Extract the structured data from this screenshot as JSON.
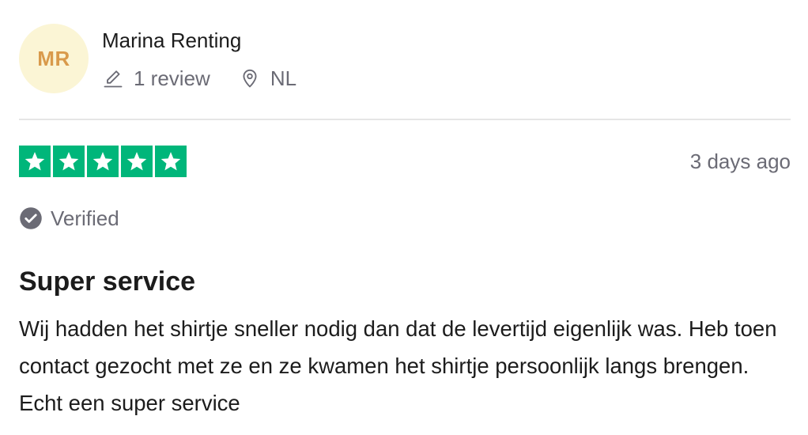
{
  "reviewer": {
    "initials": "MR",
    "name": "Marina Renting",
    "review_count": "1 review",
    "country": "NL",
    "avatar_bg": "#fbf5d5",
    "avatar_fg": "#d99a4b"
  },
  "review": {
    "rating": 5,
    "max_rating": 5,
    "star_color": "#00b67a",
    "date": "3 days ago",
    "verified_label": "Verified",
    "title": "Super service",
    "body": "Wij hadden het shirtje sneller nodig dan dat de levertijd eigenlijk was. Heb toen contact gezocht met ze en ze kwamen het shirtje persoonlijk langs brengen. Echt een super service"
  },
  "icons": {
    "review_count": "pencil-icon",
    "country": "location-pin-icon",
    "verified": "checkmark-circle-icon",
    "rating": "star-icon"
  }
}
